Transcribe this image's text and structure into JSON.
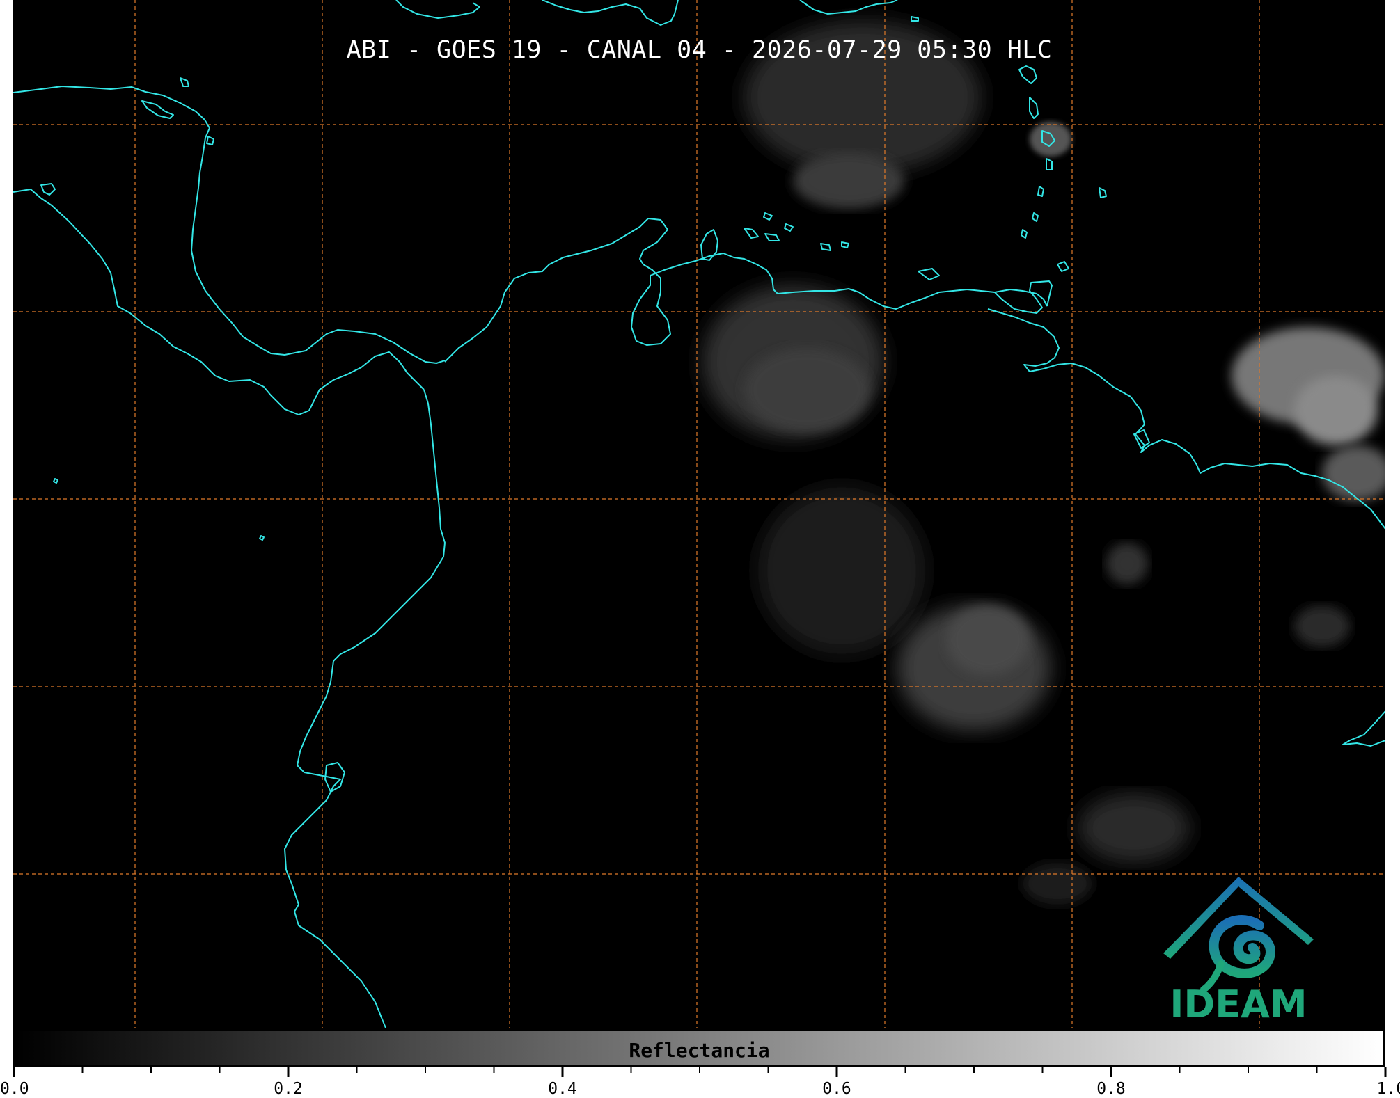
{
  "map": {
    "title": "ABI - GOES 19 - CANAL 04 - 2026-07-29 05:30 HLC",
    "coastline_color": "#33e6e6",
    "grid_color": "#e07a2a",
    "background_color": "#000000"
  },
  "logo": {
    "text": "IDEAM",
    "icon": "ideam-logo-icon"
  },
  "colorbar": {
    "label": "Reflectancia",
    "ticks": [
      {
        "value": 0.0,
        "label": "0.0"
      },
      {
        "value": 0.2,
        "label": "0.2"
      },
      {
        "value": 0.4,
        "label": "0.4"
      },
      {
        "value": 0.6,
        "label": "0.6"
      },
      {
        "value": 0.8,
        "label": "0.8"
      },
      {
        "value": 1.0,
        "label": "1.0"
      }
    ],
    "minor_step": 0.05,
    "range": [
      0.0,
      1.0
    ],
    "colormap": [
      "#000000",
      "#ffffff"
    ]
  }
}
